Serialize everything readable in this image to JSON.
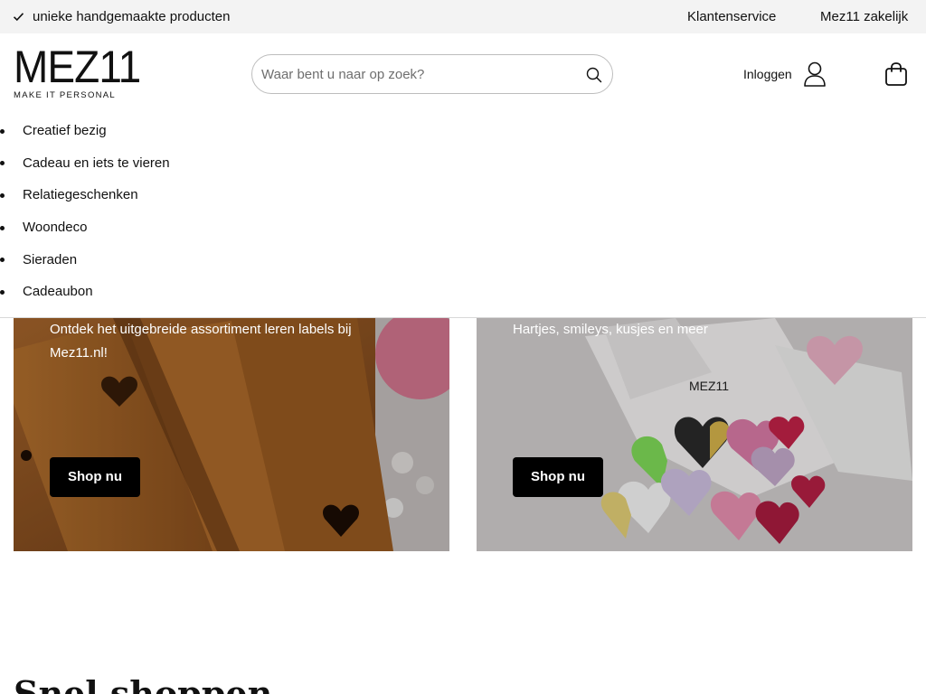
{
  "topbar": {
    "usp_text": "unieke handgemaakte producten",
    "links": {
      "service": "Klantenservice",
      "business": "Mez11 zakelijk"
    }
  },
  "header": {
    "logo_main": "MEZ11",
    "logo_tagline": "MAKE IT PERSONAL",
    "search_placeholder": "Waar bent u naar op zoek?",
    "search_value": "",
    "login_label": "Inloggen"
  },
  "menu": {
    "items": [
      "Creatief bezig",
      "Cadeau en iets te vieren",
      "Relatiegeschenken",
      "Woondeco",
      "Sieraden",
      "Cadeaubon"
    ]
  },
  "banners": {
    "left": {
      "text": "Ontdek het uitgebreide assortiment leren labels bij Mez11.nl!",
      "button": "Shop nu"
    },
    "right": {
      "text": "Hartjes, smileys, kusjes en meer",
      "button": "Shop nu",
      "card_brand": "MEZ11"
    }
  },
  "section": {
    "title": "Snel shoppen"
  },
  "colors": {
    "topbar_bg": "#f3f3f3",
    "button_bg": "#000000",
    "text": "#111111"
  }
}
